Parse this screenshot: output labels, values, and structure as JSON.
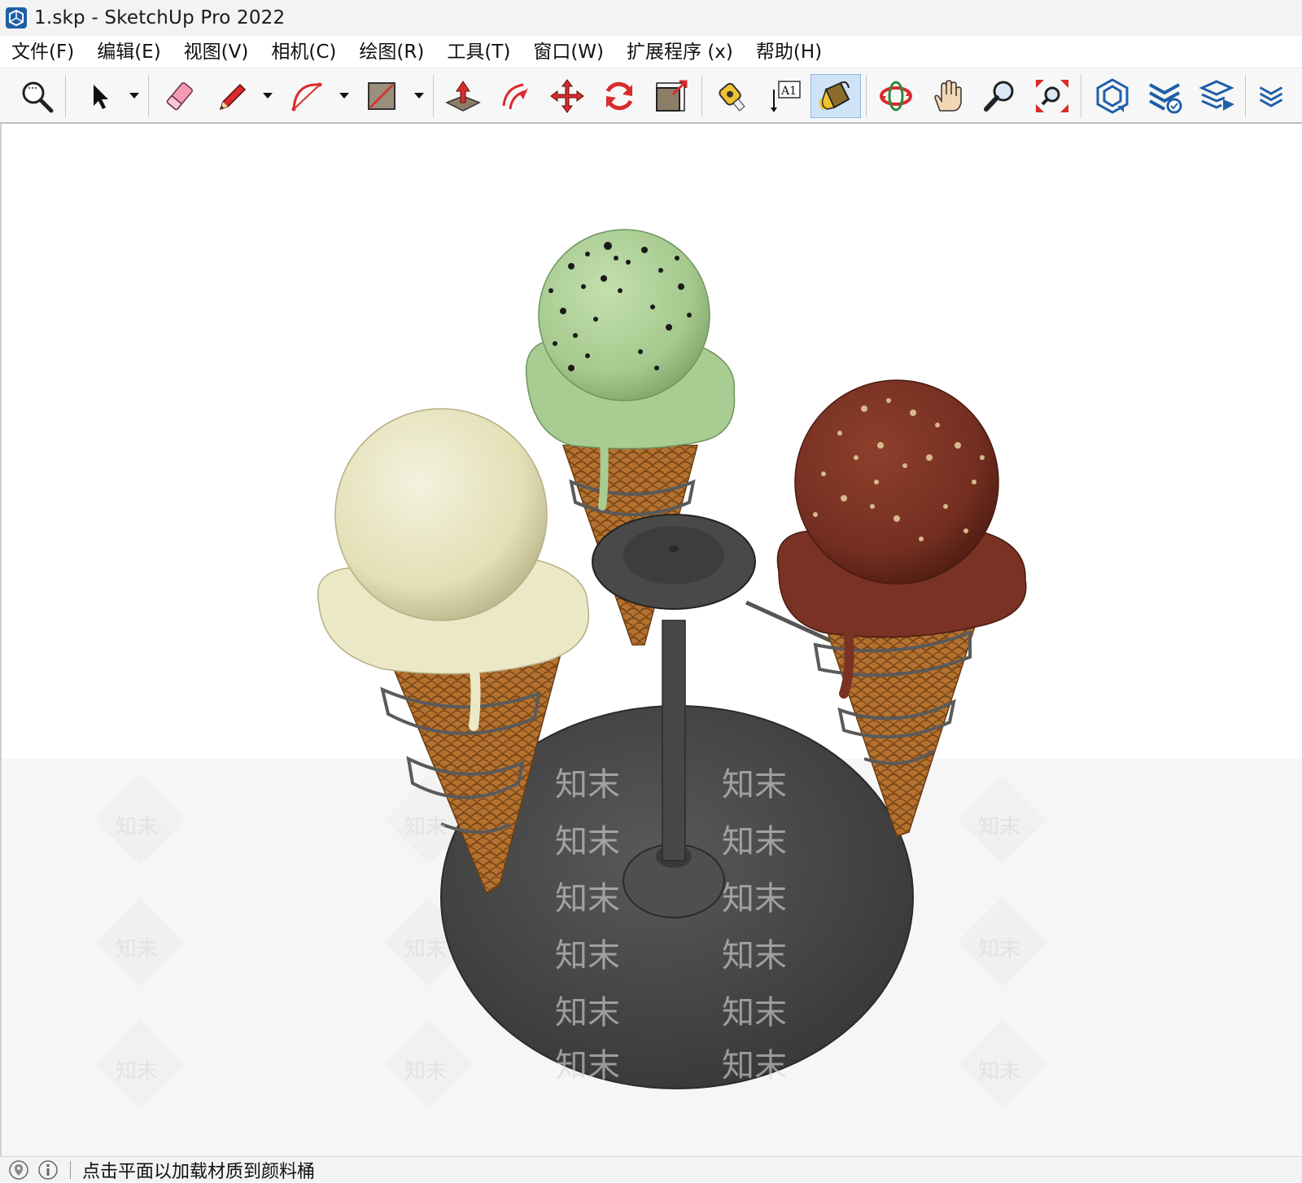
{
  "window": {
    "title": "1.skp - SketchUp Pro 2022"
  },
  "menu": {
    "items": [
      "文件(F)",
      "编辑(E)",
      "视图(V)",
      "相机(C)",
      "绘图(R)",
      "工具(T)",
      "窗口(W)",
      "扩展程序 (x)",
      "帮助(H)"
    ]
  },
  "toolbar": {
    "tools": [
      {
        "name": "zoom-window",
        "icon": "magnifier-icon"
      },
      {
        "name": "select",
        "icon": "arrow-cursor-icon",
        "dropdown": true
      },
      {
        "name": "eraser",
        "icon": "eraser-icon"
      },
      {
        "name": "line",
        "icon": "pencil-icon",
        "dropdown": true
      },
      {
        "name": "arc",
        "icon": "arc-icon",
        "dropdown": true
      },
      {
        "name": "rectangle",
        "icon": "rectangle-icon",
        "dropdown": true
      },
      {
        "name": "push-pull",
        "icon": "push-pull-icon"
      },
      {
        "name": "offset",
        "icon": "offset-icon"
      },
      {
        "name": "move",
        "icon": "move-icon"
      },
      {
        "name": "rotate",
        "icon": "rotate-icon"
      },
      {
        "name": "scale",
        "icon": "scale-icon"
      },
      {
        "name": "tape-measure",
        "icon": "tape-measure-icon"
      },
      {
        "name": "text",
        "icon": "text-icon"
      },
      {
        "name": "paint-bucket",
        "icon": "paint-bucket-icon",
        "active": true
      },
      {
        "name": "orbit",
        "icon": "orbit-icon"
      },
      {
        "name": "pan",
        "icon": "hand-icon"
      },
      {
        "name": "zoom",
        "icon": "zoom-icon"
      },
      {
        "name": "zoom-extents",
        "icon": "zoom-extents-icon"
      },
      {
        "name": "3d-warehouse",
        "icon": "warehouse-icon"
      },
      {
        "name": "extension-warehouse",
        "icon": "extension-warehouse-icon"
      },
      {
        "name": "send-to-layout",
        "icon": "layout-icon"
      }
    ]
  },
  "viewport": {
    "watermark_text": "知末",
    "colors": {
      "vanilla": "#e9e6c4",
      "pistachio": "#a8cc92",
      "chocolate": "#7a3224",
      "cone": "#b5722f",
      "stand": "#4a4a4a"
    }
  },
  "status": {
    "message": "点击平面以加载材质到颜料桶"
  }
}
